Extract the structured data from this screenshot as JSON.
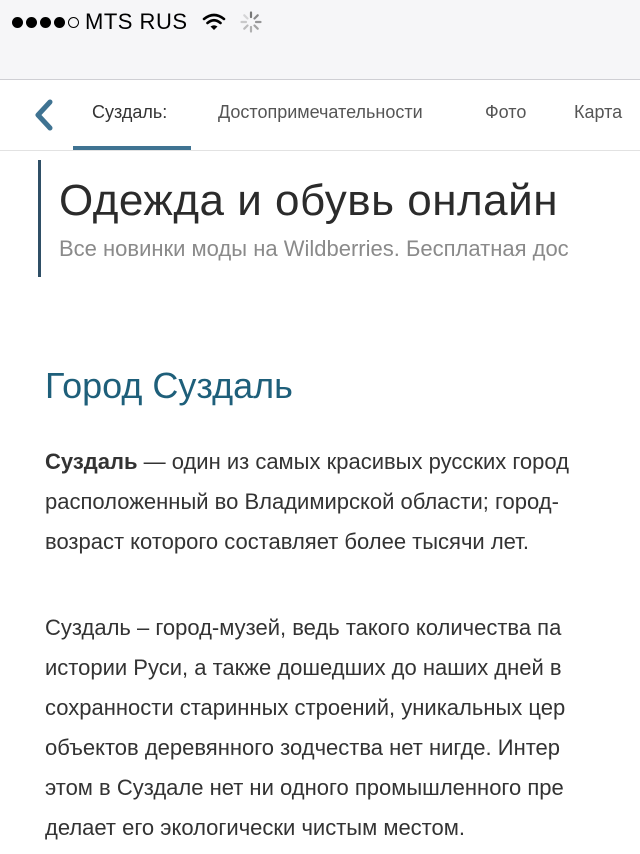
{
  "status_bar": {
    "signal_bars_filled": 4,
    "signal_bars_total": 5,
    "carrier": "MTS RUS",
    "icons": [
      "wifi-icon",
      "activity-spinner-icon"
    ]
  },
  "nav": {
    "back_icon": "chevron-left-icon",
    "tabs": [
      {
        "label": "Суздаль:",
        "active": true
      },
      {
        "label": "Достопримечательности"
      },
      {
        "label": "Фото"
      },
      {
        "label": "Карта"
      }
    ]
  },
  "ad": {
    "title": "Одежда и обувь онлайн",
    "subtitle": "Все новинки моды на Wildberries. Бесплатная дос"
  },
  "article": {
    "heading": "Город Суздаль",
    "p1": {
      "bold": "Суздаль",
      "line1": " — один из самых красивых русских город",
      "line2": "расположенный во Владимирской области; город-",
      "line3": "возраст которого составляет более тысячи лет."
    },
    "p2": {
      "line1": "Суздаль – город-музей, ведь такого количества па",
      "line2": "истории Руси, а также дошедших до наших дней в",
      "line3": "сохранности старинных строений, уникальных цер",
      "line4": "объектов деревянного зодчества нет нигде. Интер",
      "line5": "этом в Суздале нет ни одного промышленного пре",
      "line6": "делает его экологически чистым местом."
    }
  },
  "colors": {
    "accent": "#3f7392",
    "heading": "#1e5f7a",
    "ad_border": "#2f4f66"
  }
}
